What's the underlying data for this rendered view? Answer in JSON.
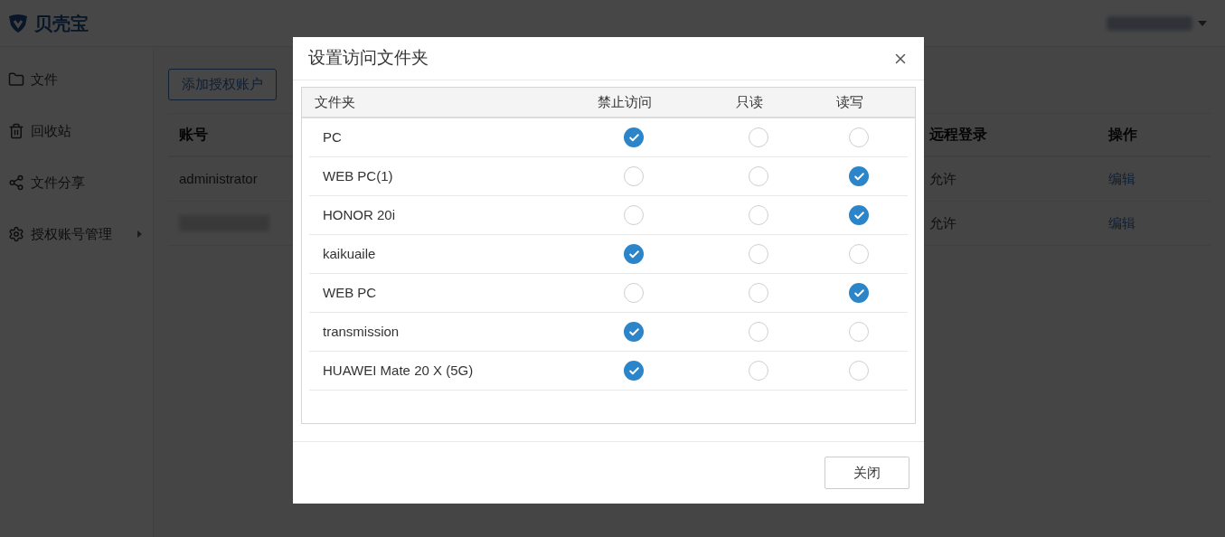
{
  "app": {
    "logo": "贝壳宝",
    "sidebar": [
      {
        "label": "文件",
        "has_submenu": false
      },
      {
        "label": "回收站",
        "has_submenu": false
      },
      {
        "label": "文件分享",
        "has_submenu": false
      },
      {
        "label": "授权账号管理",
        "has_submenu": true
      }
    ],
    "add_button": "添加授权账户",
    "table": {
      "columns": [
        "账号",
        "远程登录",
        "操作"
      ],
      "rows": [
        {
          "account": "administrator",
          "remote_login": "允许",
          "action": "编辑"
        },
        {
          "account_blurred": true,
          "remote_login": "允许",
          "action": "编辑"
        }
      ]
    }
  },
  "dialog": {
    "title": "设置访问文件夹",
    "columns": [
      "文件夹",
      "禁止访问",
      "只读",
      "读写"
    ],
    "rows": [
      {
        "name": "PC",
        "options": [
          {
            "selected": true
          },
          {
            "selected": false
          },
          {
            "selected": false
          }
        ]
      },
      {
        "name": "WEB PC(1)",
        "options": [
          {
            "selected": false
          },
          {
            "selected": false
          },
          {
            "selected": true
          }
        ]
      },
      {
        "name": "HONOR 20i",
        "options": [
          {
            "selected": false
          },
          {
            "selected": false
          },
          {
            "selected": true
          }
        ]
      },
      {
        "name": "kaikuaile",
        "options": [
          {
            "selected": true
          },
          {
            "selected": false
          },
          {
            "selected": false
          }
        ]
      },
      {
        "name": "WEB PC",
        "options": [
          {
            "selected": false
          },
          {
            "selected": false
          },
          {
            "selected": true
          }
        ]
      },
      {
        "name": "transmission",
        "options": [
          {
            "selected": true
          },
          {
            "selected": false
          },
          {
            "selected": false
          }
        ]
      },
      {
        "name": "HUAWEI Mate 20 X (5G)",
        "options": [
          {
            "selected": true
          },
          {
            "selected": false
          },
          {
            "selected": false
          }
        ]
      }
    ],
    "buttons": [
      "关闭"
    ]
  }
}
